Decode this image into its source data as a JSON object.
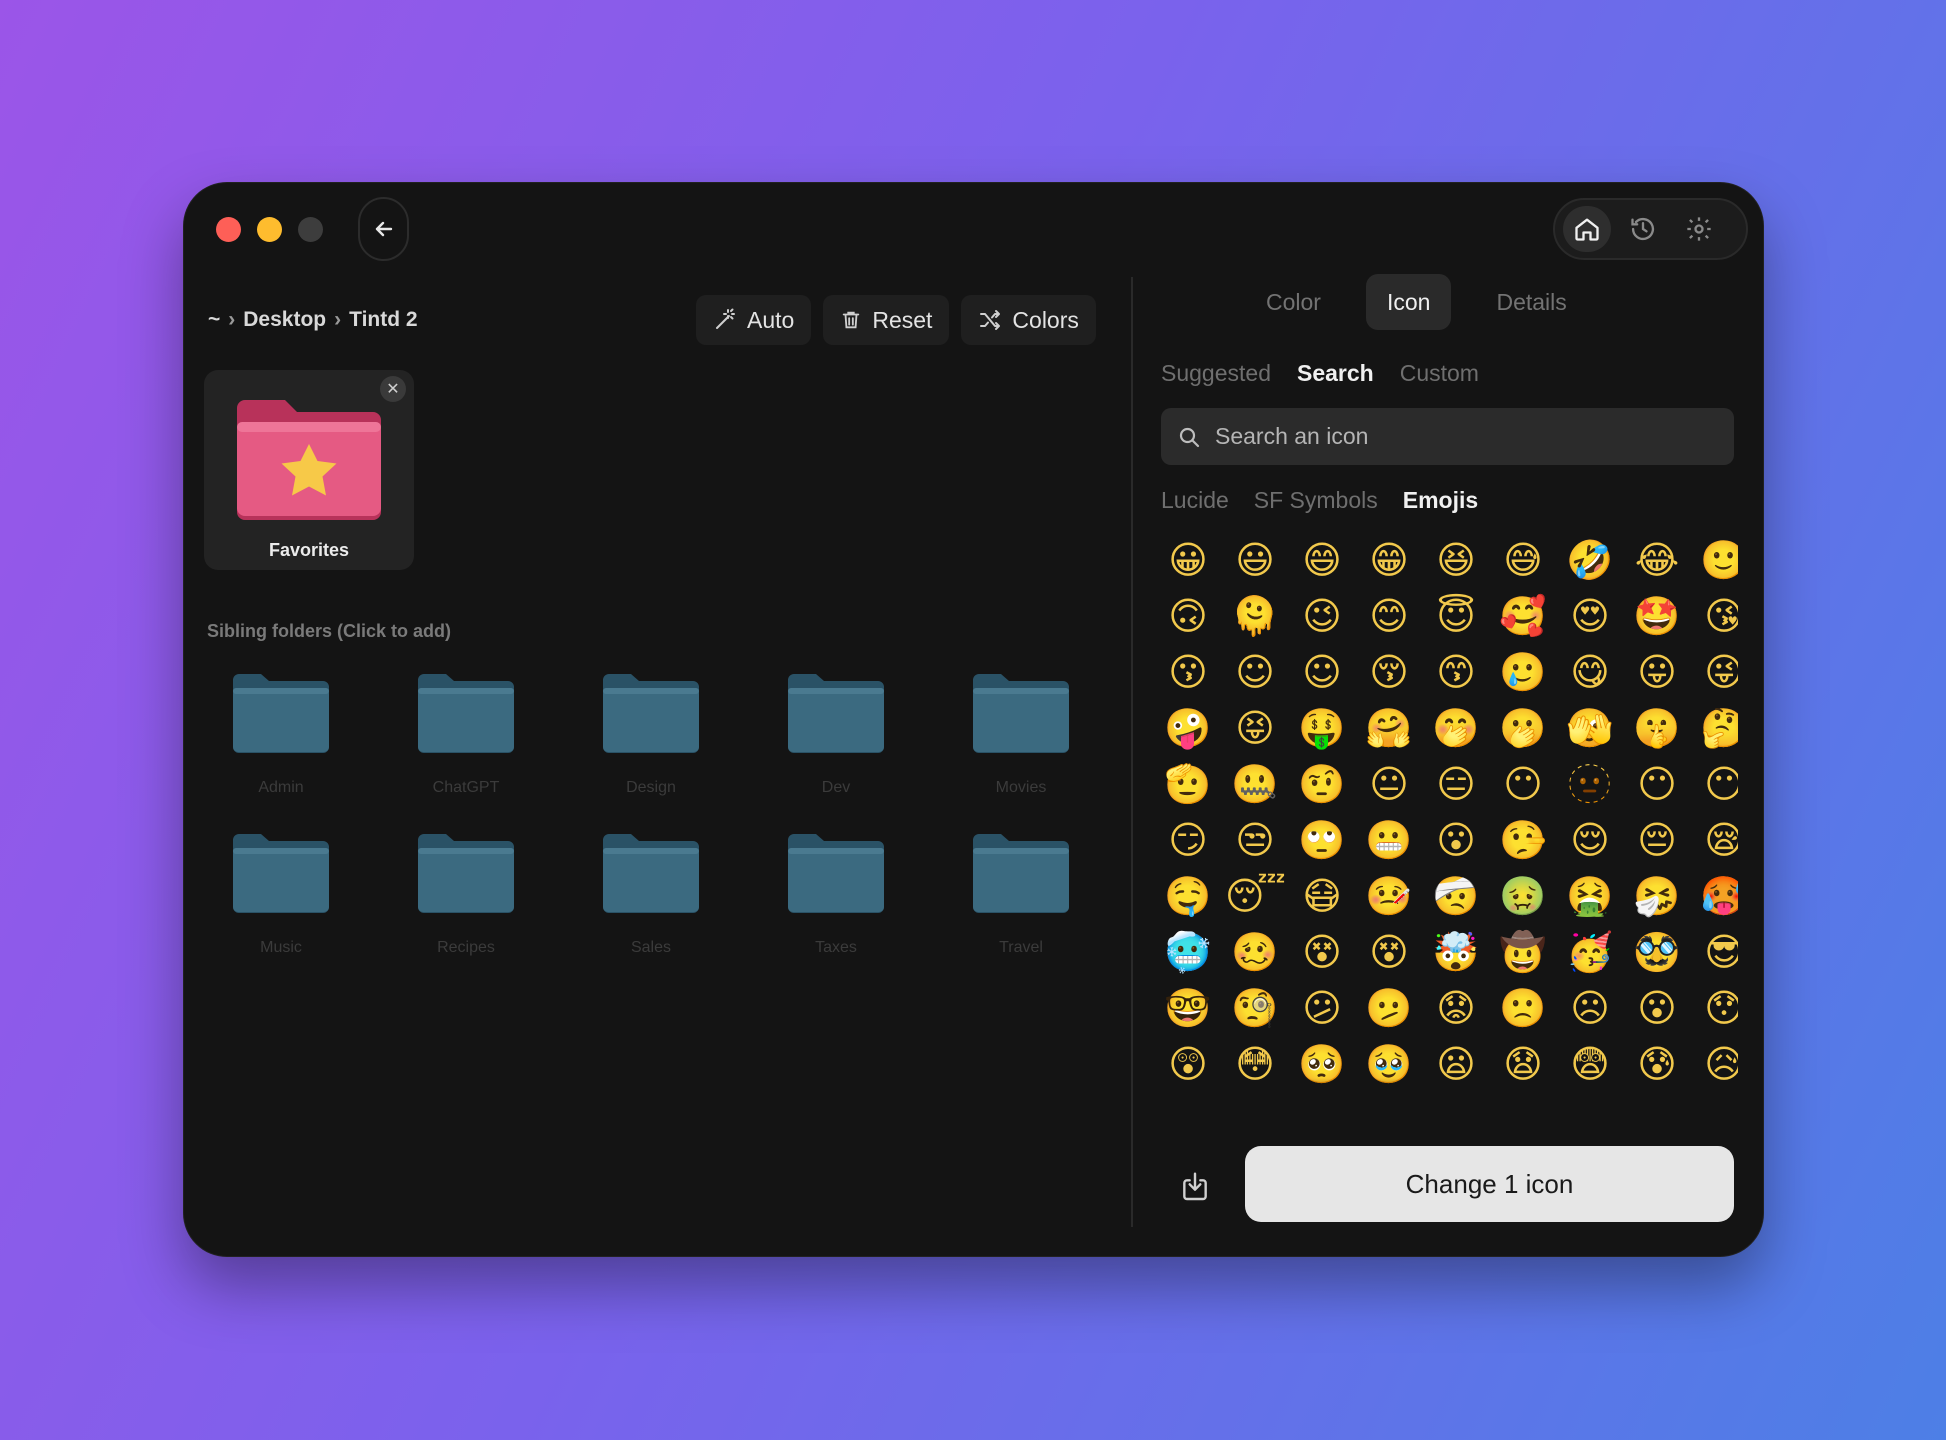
{
  "breadcrumb": {
    "home": "~",
    "separator": "›",
    "items": [
      "Desktop",
      "Tintd 2"
    ]
  },
  "actions": {
    "auto": "Auto",
    "reset": "Reset",
    "colors": "Colors"
  },
  "favorite": {
    "label": "Favorites",
    "close_glyph": "✕"
  },
  "siblings": {
    "title": "Sibling folders (Click to add)",
    "folders": [
      "Admin",
      "ChatGPT",
      "Design",
      "Dev",
      "Movies",
      "Music",
      "Recipes",
      "Sales",
      "Taxes",
      "Travel"
    ]
  },
  "tabs": [
    {
      "label": "Color",
      "active": false
    },
    {
      "label": "Icon",
      "active": true
    },
    {
      "label": "Details",
      "active": false
    }
  ],
  "subtabs": [
    {
      "label": "Suggested",
      "active": false
    },
    {
      "label": "Search",
      "active": true
    },
    {
      "label": "Custom",
      "active": false
    }
  ],
  "search": {
    "placeholder": "Search an icon"
  },
  "sources": [
    {
      "label": "Lucide",
      "active": false
    },
    {
      "label": "SF Symbols",
      "active": false
    },
    {
      "label": "Emojis",
      "active": true
    }
  ],
  "emojis": [
    "😀",
    "😃",
    "😄",
    "😁",
    "😆",
    "😅",
    "🤣",
    "😂",
    "🙂",
    "🙃",
    "🫠",
    "😉",
    "😊",
    "😇",
    "🥰",
    "😍",
    "🤩",
    "😘",
    "😗",
    "☺",
    "☺",
    "😚",
    "😙",
    "🥲",
    "😋",
    "😛",
    "😜",
    "🤪",
    "😝",
    "🤑",
    "🤗",
    "🤭",
    "🫢",
    "🫣",
    "🤫",
    "🤔",
    "🫡",
    "🤐",
    "🤨",
    "😐",
    "😑",
    "😶",
    "🫥",
    "😶",
    "😶",
    "😏",
    "😒",
    "🙄",
    "😬",
    "😮",
    "🤥",
    "😌",
    "😔",
    "😪",
    "🤤",
    "😴",
    "😷",
    "🤒",
    "🤕",
    "🤢",
    "🤮",
    "🤧",
    "🥵",
    "🥶",
    "🥴",
    "😵",
    "😵",
    "🤯",
    "🤠",
    "🥳",
    "🥸",
    "😎",
    "🤓",
    "🧐",
    "😕",
    "🫤",
    "😟",
    "🙁",
    "☹",
    "😮",
    "😯",
    "😲",
    "😳",
    "🥺",
    "🥹",
    "😦",
    "😧",
    "😨",
    "😰",
    "😥"
  ],
  "footer": {
    "change_button": "Change 1 icon"
  },
  "colors": {
    "window_bg": "#141414",
    "folder_teal": "#3b6a80",
    "favorites_pink": "#e2527a",
    "accent_star": "#f7c948"
  },
  "icons": {
    "back": "arrow-left-icon",
    "home": "house-icon",
    "history": "clock-history-icon",
    "settings": "gear-icon",
    "auto": "magic-wand-icon",
    "reset": "trash-icon",
    "colors": "shuffle-icon",
    "search": "magnifier-icon",
    "export": "tray-download-icon"
  }
}
